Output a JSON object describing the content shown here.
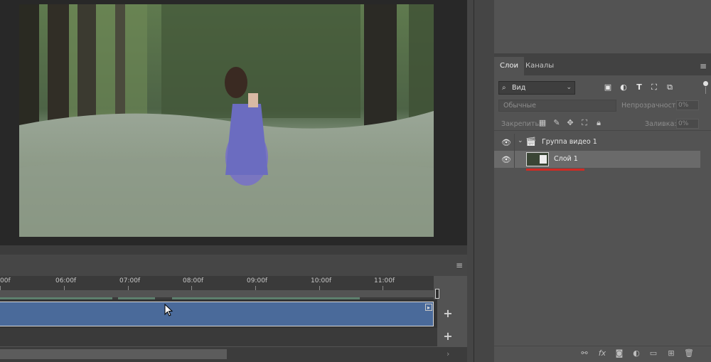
{
  "timeline": {
    "ticks": [
      "00f",
      "06:00f",
      "07:00f",
      "08:00f",
      "09:00f",
      "10:00f",
      "11:00f"
    ],
    "menu_icon": "≡",
    "add_track": "+"
  },
  "layers_panel": {
    "tabs": [
      {
        "label": "Слои"
      },
      {
        "label": "Каналы"
      }
    ],
    "filter": {
      "selected": "Вид"
    },
    "filter_icons": [
      "image-filter-icon",
      "adjustment-filter-icon",
      "type-filter-icon",
      "shape-filter-icon",
      "smart-object-filter-icon"
    ],
    "blend_mode": "Обычные",
    "opacity_label": "Непрозрачность:",
    "opacity_value": "0%",
    "lock_label": "Закрепить:",
    "fill_label": "Заливка:",
    "fill_value": "0%",
    "layers": [
      {
        "name": "Группа видео 1",
        "type": "video-group"
      },
      {
        "name": "Слой 1",
        "type": "video-layer",
        "selected": true
      }
    ],
    "bottom_icons": [
      "link-icon",
      "fx-icon",
      "mask-icon",
      "adjustment-icon",
      "folder-icon",
      "new-layer-icon",
      "trash-icon"
    ]
  },
  "colors": {
    "clip": "#4a6a9a",
    "selected_layer": "#6a6a6a",
    "underline_annotation": "#d02a24",
    "work_area": "#5d7f6d"
  }
}
